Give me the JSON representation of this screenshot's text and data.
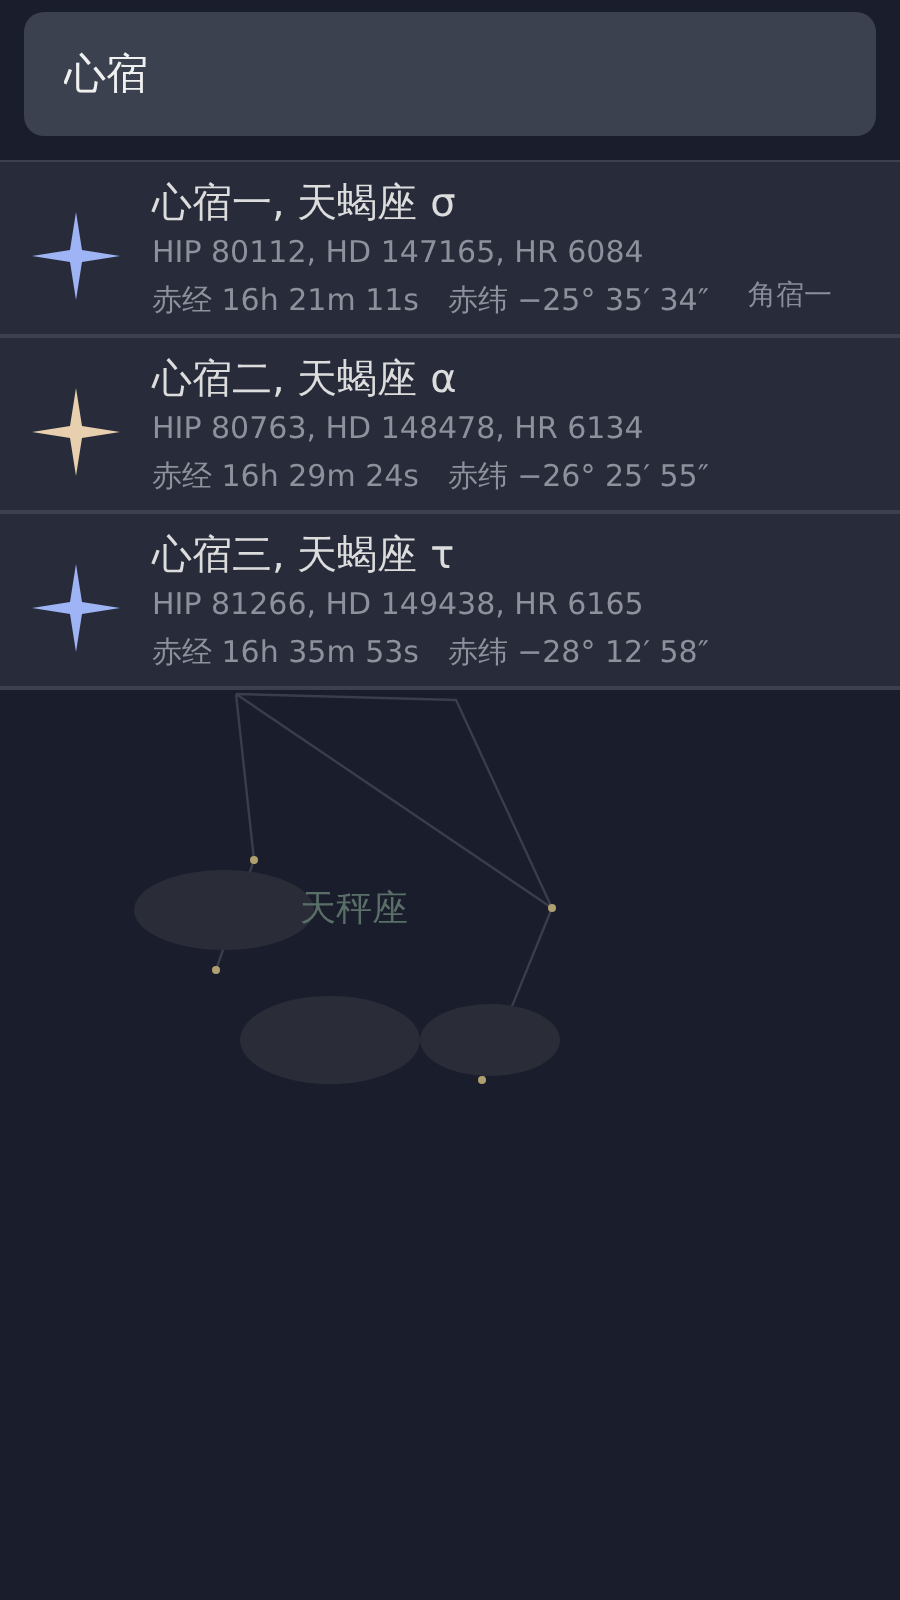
{
  "search": {
    "value": "心宿"
  },
  "results": [
    {
      "title": "心宿一, 天蝎座 σ",
      "catalog": "HIP 80112, HD 147165, HR 6084",
      "coordinates": "赤经 16h 21m 11s   赤纬 −25° 35′ 34″",
      "color": "#9fb4f5"
    },
    {
      "title": "心宿二, 天蝎座 α",
      "catalog": "HIP 80763, HD 148478, HR 6134",
      "coordinates": "赤经 16h 29m 24s   赤纬 −26° 25′ 55″",
      "color": "#e8cfae"
    },
    {
      "title": "心宿三, 天蝎座 τ",
      "catalog": "HIP 81266, HD 149438, HR 6165",
      "coordinates": "赤经 16h 35m 53s   赤纬 −28° 12′ 58″",
      "color": "#9fb4f5"
    }
  ],
  "sky_labels": [
    "角宿一",
    "天秤座"
  ]
}
